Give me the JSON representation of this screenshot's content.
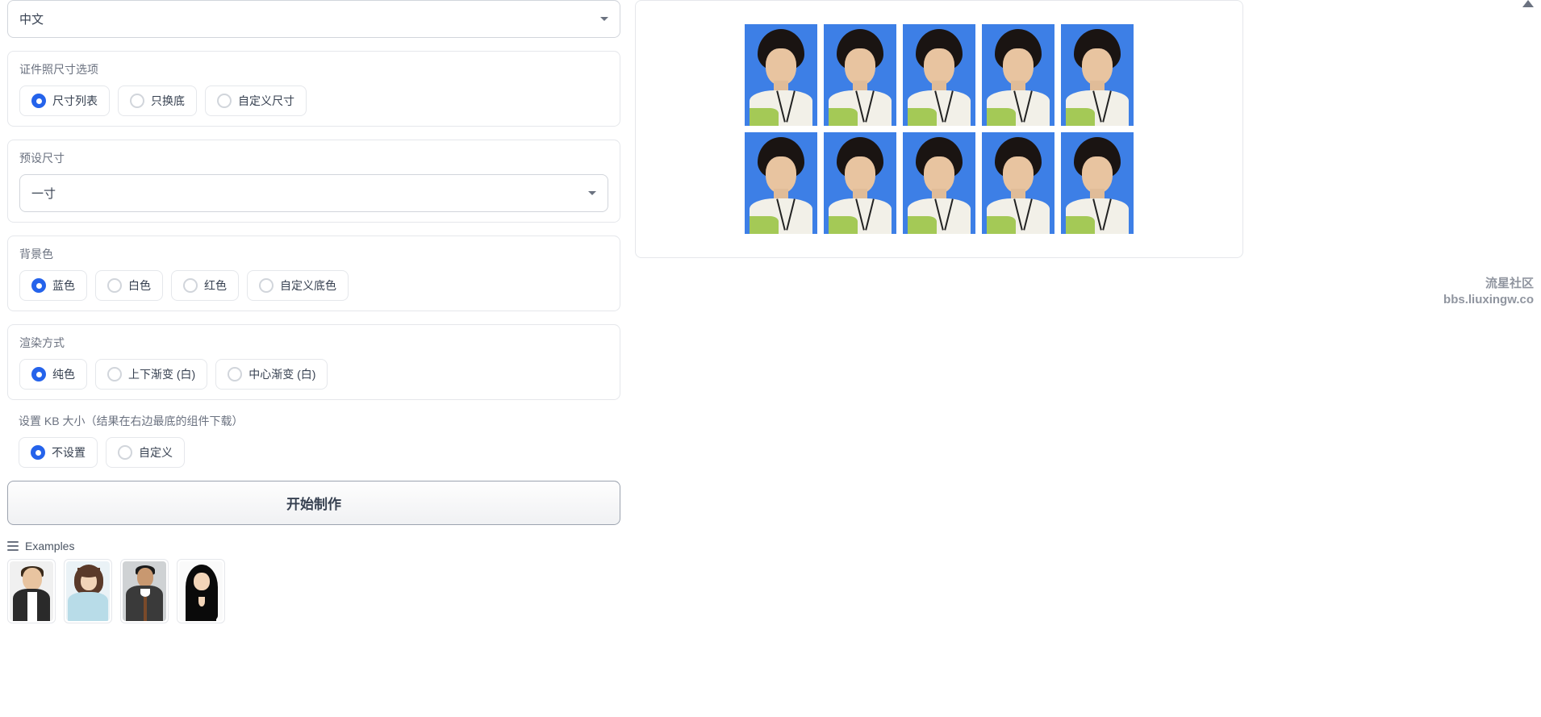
{
  "language": {
    "selected": "中文"
  },
  "sizeOption": {
    "label": "证件照尺寸选项",
    "options": [
      {
        "label": "尺寸列表",
        "selected": true
      },
      {
        "label": "只换底",
        "selected": false
      },
      {
        "label": "自定义尺寸",
        "selected": false
      }
    ]
  },
  "presetSize": {
    "label": "预设尺寸",
    "selected": "一寸"
  },
  "bgColor": {
    "label": "背景色",
    "options": [
      {
        "label": "蓝色",
        "selected": true
      },
      {
        "label": "白色",
        "selected": false
      },
      {
        "label": "红色",
        "selected": false
      },
      {
        "label": "自定义底色",
        "selected": false
      }
    ]
  },
  "renderMode": {
    "label": "渲染方式",
    "options": [
      {
        "label": "纯色",
        "selected": true
      },
      {
        "label": "上下渐变 (白)",
        "selected": false
      },
      {
        "label": "中心渐变 (白)",
        "selected": false
      }
    ]
  },
  "kbSize": {
    "label": "设置 KB 大小（结果在右边最底的组件下载）",
    "options": [
      {
        "label": "不设置",
        "selected": true
      },
      {
        "label": "自定义",
        "selected": false
      }
    ]
  },
  "submit": {
    "label": "开始制作"
  },
  "examples": {
    "label": "Examples",
    "count": 4
  },
  "output": {
    "rows": 2,
    "cols": 5
  },
  "watermark": {
    "line1": "流星社区",
    "line2": "bbs.liuxingw.co"
  }
}
